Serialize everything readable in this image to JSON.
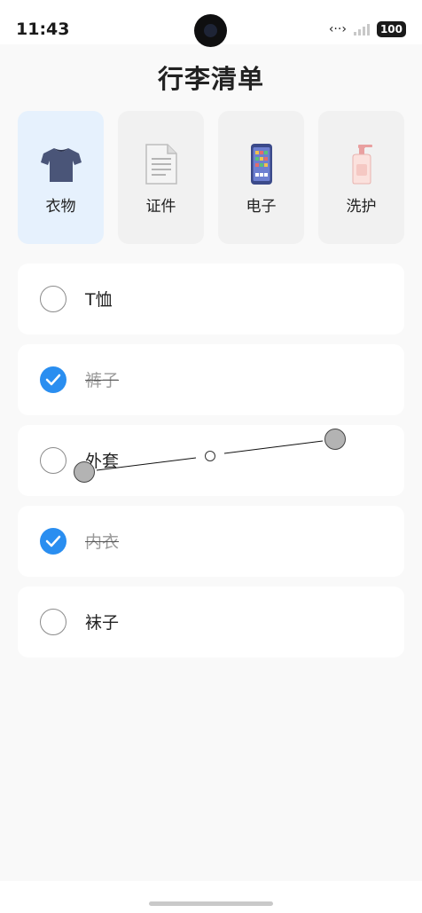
{
  "status_bar": {
    "time": "11:43",
    "battery": "100"
  },
  "page": {
    "title": "行李清单"
  },
  "categories": [
    {
      "label": "衣物",
      "icon": "tshirt-icon",
      "active": true
    },
    {
      "label": "证件",
      "icon": "document-icon",
      "active": false
    },
    {
      "label": "电子",
      "icon": "phone-icon",
      "active": false
    },
    {
      "label": "洗护",
      "icon": "lotion-bottle-icon",
      "active": false
    }
  ],
  "items": [
    {
      "label": "T恤",
      "checked": false
    },
    {
      "label": "裤子",
      "checked": true
    },
    {
      "label": "外套",
      "checked": false
    },
    {
      "label": "内衣",
      "checked": true
    },
    {
      "label": "袜子",
      "checked": false
    }
  ],
  "colors": {
    "accent": "#2a8ef0",
    "active_category_bg": "#e6f1fd",
    "card_bg": "#ffffff",
    "page_bg": "#f9f9f9"
  }
}
